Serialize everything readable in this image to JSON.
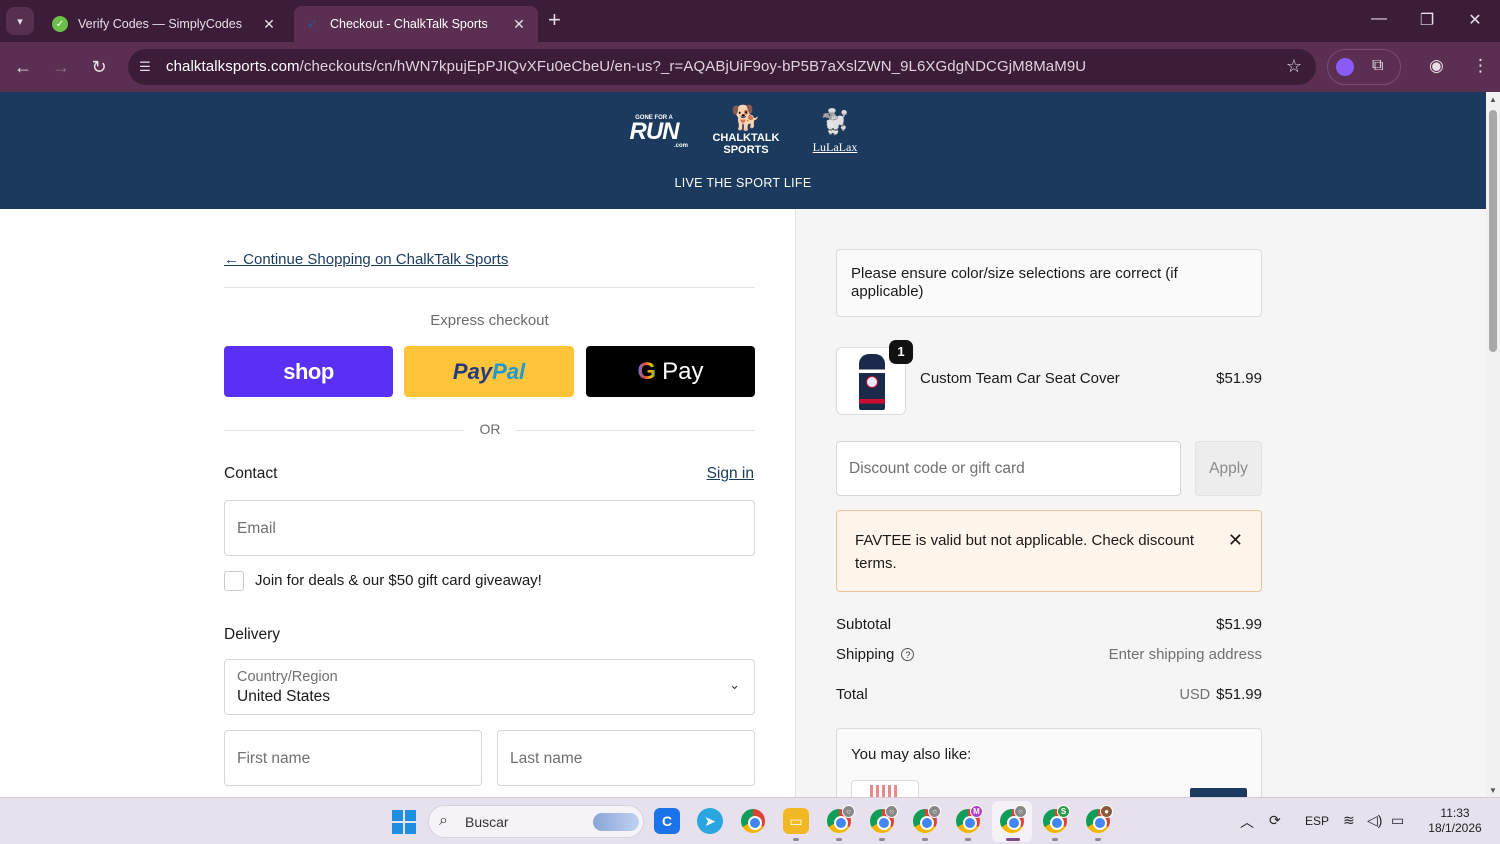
{
  "browser": {
    "tabs": [
      {
        "title": "Verify Codes — SimplyCodes",
        "active": false
      },
      {
        "title": "Checkout - ChalkTalk Sports",
        "active": true
      }
    ],
    "url_host": "chalktalksports.com",
    "url_path": "/checkouts/cn/hWN7kpujEpPJIQvXFu0eCbeU/en-us?_r=AQABjUiF9oy-bP5B7aXslZWN_9L6XGdgNDCGjM8MaM9U"
  },
  "store": {
    "logos": {
      "run_small": "GONE FOR A",
      "run_big": "RUN",
      "run_com": ".com",
      "ct_line1": "CHALKTALK",
      "ct_line2": "SPORTS",
      "lulalax": "LuLaLax"
    },
    "tagline": "LIVE THE SPORT LIFE"
  },
  "checkout": {
    "continue_link": "← Continue Shopping on ChalkTalk Sports",
    "express_label": "Express checkout",
    "shop_label": "shop",
    "paypal_p1": "Pay",
    "paypal_p2": "Pal",
    "gpay_g": "G",
    "gpay_label": "Pay",
    "or_label": "OR",
    "contact_title": "Contact",
    "signin_label": "Sign in",
    "email_placeholder": "Email",
    "newsletter_label": "Join for deals & our $50 gift card giveaway!",
    "delivery_title": "Delivery",
    "country_label": "Country/Region",
    "country_value": "United States",
    "first_name_placeholder": "First name",
    "last_name_placeholder": "Last name"
  },
  "summary": {
    "notice": "Please ensure color/size selections are correct (if applicable)",
    "product": {
      "name": "Custom Team Car Seat Cover",
      "price": "$51.99",
      "quantity": "1"
    },
    "discount_placeholder": "Discount code or gift card",
    "apply_label": "Apply",
    "error": "FAVTEE is valid but not applicable. Check discount terms.",
    "subtotal_label": "Subtotal",
    "subtotal_value": "$51.99",
    "shipping_label": "Shipping",
    "shipping_value": "Enter shipping address",
    "total_label": "Total",
    "total_currency": "USD",
    "total_value": "$51.99",
    "also_like": "You may also like:"
  },
  "taskbar": {
    "search_label": "Buscar",
    "language": "ESP",
    "time": "11:33",
    "date": "18/1/2026",
    "profile_badges": [
      "M",
      "S"
    ]
  },
  "colors": {
    "header_bg": "#1b3a5e",
    "shop_pay": "#5a31f4",
    "paypal": "#ffc439",
    "error_bg": "#fff5ea",
    "browser_frame": "#5a2f51"
  }
}
